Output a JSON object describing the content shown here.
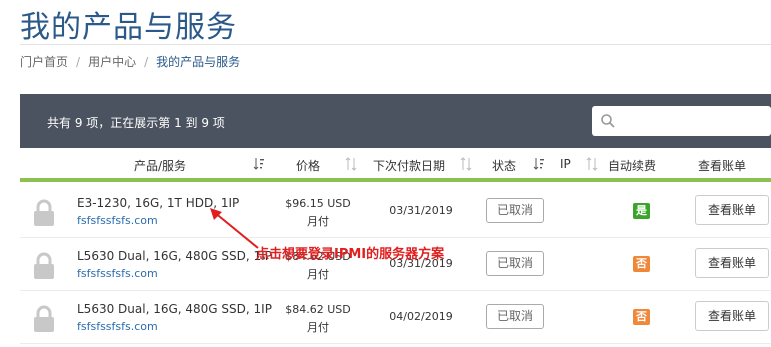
{
  "page": {
    "title": "我的产品与服务"
  },
  "breadcrumb": [
    "门户首页",
    "用户中心",
    "我的产品与服务"
  ],
  "listbar": {
    "summary": "共有 9 项，正在展示第 1 到 9 项"
  },
  "table": {
    "headers": {
      "product": "产品/服务",
      "price": "价格",
      "due": "下次付款日期",
      "status": "状态",
      "ip": "IP",
      "autorenew": "自动续费",
      "view": "查看账单"
    },
    "rows": [
      {
        "name": "E3-1230, 16G, 1T HDD, 1IP",
        "domain": "fsfsfssfsfs.com",
        "price": "$96.15 USD",
        "cycle": "月付",
        "due": "03/31/2019",
        "status": "已取消",
        "renew": "是",
        "renew_color": "#3aa52a",
        "view": "查看账单"
      },
      {
        "name": "L5630 Dual, 16G, 480G SSD, 1IP",
        "domain": "fsfsfssfsfs.com",
        "price": "$84.62 USD",
        "cycle": "月付",
        "due": "03/31/2019",
        "status": "已取消",
        "renew": "否",
        "renew_color": "#f0883a",
        "view": "查看账单"
      },
      {
        "name": "L5630 Dual, 16G, 480G SSD, 1IP",
        "domain": "fsfsfssfsfs.com",
        "price": "$84.62 USD",
        "cycle": "月付",
        "due": "04/02/2019",
        "status": "已取消",
        "renew": "否",
        "renew_color": "#f0883a",
        "view": "查看账单"
      }
    ]
  },
  "annotation": {
    "text": "点击想要登录IPMI的服务器方案",
    "color": "#e02020"
  },
  "icons": {
    "search": "search-icon",
    "sort": "sort-icon",
    "lock": "lock-icon"
  }
}
